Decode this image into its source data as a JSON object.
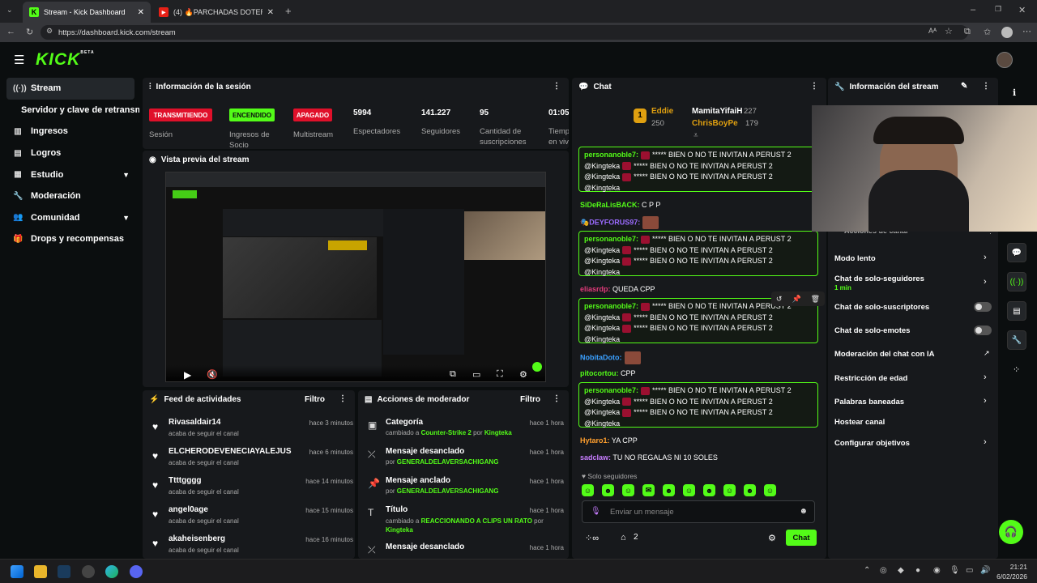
{
  "browser": {
    "tabs": [
      {
        "title": "Stream - Kick Dashboard"
      },
      {
        "title": "(4) 🔥PARCHADAS DOTERAS🔥 KIC"
      }
    ],
    "url": "https://dashboard.kick.com/stream"
  },
  "app": {
    "logo": "KICK",
    "logo_tag": "BETA"
  },
  "sidebar": {
    "items": [
      {
        "label": "Stream",
        "icon": "stream-icon"
      },
      {
        "label": "Servidor y clave de retransmisión",
        "icon": ""
      },
      {
        "label": "Ingresos",
        "icon": "chart-icon"
      },
      {
        "label": "Logros",
        "icon": "book-icon"
      },
      {
        "label": "Estudio",
        "icon": "grid-icon"
      },
      {
        "label": "Moderación",
        "icon": "wrench-icon"
      },
      {
        "label": "Comunidad",
        "icon": "people-icon"
      },
      {
        "label": "Drops y recompensas",
        "icon": "gift-icon"
      }
    ]
  },
  "session": {
    "title": "Información de la sesión",
    "badges": [
      {
        "label": "TRANSMITIENDO",
        "desc": "Sesión"
      },
      {
        "label": "ENCENDIDO",
        "desc": "Ingresos de Socio"
      },
      {
        "label": "APAGADO",
        "desc": "Multistream"
      }
    ],
    "stats": [
      {
        "value": "5994",
        "label": "Espectadores"
      },
      {
        "value": "141.227",
        "label": "Seguidores"
      },
      {
        "value": "95",
        "label": "Cantidad de suscripciones"
      },
      {
        "value": "01:05",
        "label": "Tiempo en vivo"
      }
    ]
  },
  "preview": {
    "title": "Vista previa del stream"
  },
  "feed": {
    "title": "Feed de actividades",
    "filter": "Filtro",
    "items": [
      {
        "name": "Rivasaldair14",
        "sub": "acaba de seguir el canal",
        "time": "hace 3 minutos"
      },
      {
        "name": "ELCHERODEVENECIAYALEJUS",
        "sub": "acaba de seguir el canal",
        "time": "hace 6 minutos"
      },
      {
        "name": "Ttttgggg",
        "sub": "acaba de seguir el canal",
        "time": "hace 14 minutos"
      },
      {
        "name": "angel0age",
        "sub": "acaba de seguir el canal",
        "time": "hace 15 minutos"
      },
      {
        "name": "akaheisenberg",
        "sub": "acaba de seguir el canal",
        "time": "hace 16 minutos"
      }
    ]
  },
  "modactions": {
    "title": "Acciones de moderador",
    "filter": "Filtro",
    "items": [
      {
        "name": "Categoría",
        "pre": "cambiado a",
        "target": "Counter-Strike 2",
        "mid": "por",
        "user": "Kingteka",
        "time": "hace 1 hora"
      },
      {
        "name": "Mensaje desanclado",
        "pre": "por",
        "target": "",
        "mid": "",
        "user": "GENERALDELAVERSACHIGANG",
        "time": "hace 1 hora"
      },
      {
        "name": "Mensaje anclado",
        "pre": "por",
        "target": "",
        "mid": "",
        "user": "GENERALDELAVERSACHIGANG",
        "time": "hace 1 hora"
      },
      {
        "name": "Título",
        "pre": "cambiado a",
        "target": "REACCIONANDO A CLIPS UN RATO",
        "mid": "por",
        "user": "Kingteka",
        "time": "hace 1 hora"
      },
      {
        "name": "Mensaje desanclado",
        "pre": "",
        "target": "",
        "mid": "",
        "user": "",
        "time": "hace 1 hora"
      }
    ]
  },
  "chat": {
    "title": "Chat",
    "leaders": [
      {
        "name": "Eddie",
        "count": "250",
        "rank": "1"
      },
      {
        "name": "MamitaYifaiH",
        "count": "227"
      },
      {
        "name": "ChrisBoyPe",
        "count": "179"
      }
    ],
    "messages": [
      {
        "type": "hl",
        "user": "personanoble7:",
        "lines": [
          "***** BIEN O NO TE INVITAN A PERUST 2",
          "***** BIEN O NO TE INVITAN A PERUST 2",
          "***** BIEN O NO TE INVITAN A PERUST 2"
        ],
        "mention": "@Kingteka"
      },
      {
        "type": "line",
        "user": "SiDeRaLisBACK:",
        "text": "C P P",
        "color": "#53fc18"
      },
      {
        "type": "line",
        "user": "DEYFORUS97:",
        "text": "",
        "color": "#9b6bff"
      },
      {
        "type": "hl",
        "user": "personanoble7:",
        "lines": [
          "***** BIEN O NO TE INVITAN A PERUST 2",
          "***** BIEN O NO TE INVITAN A PERUST 2",
          "***** BIEN O NO TE INVITAN A PERUST 2"
        ],
        "mention": "@Kingteka"
      },
      {
        "type": "line",
        "user": "eliasrdp:",
        "text": "QUEDA CPP",
        "color": "#e03a7a"
      },
      {
        "type": "hl",
        "user": "personanoble7:",
        "lines": [
          "***** BIEN O NO TE INVITAN A PERUST 2",
          "***** BIEN O NO TE INVITAN A PERUST 2",
          "***** BIEN O NO TE INVITAN A PERUST 2"
        ],
        "mention": "@Kingteka"
      },
      {
        "type": "line",
        "user": "NobitaDoto:",
        "text": "",
        "color": "#3ba0ff"
      },
      {
        "type": "line",
        "user": "pitocortou:",
        "text": "CPP",
        "color": "#53fc18"
      },
      {
        "type": "hl",
        "user": "personanoble7:",
        "lines": [
          "***** BIEN O NO TE INVITAN A PERUST 2",
          "***** BIEN O NO TE INVITAN A PERUST 2",
          "***** BIEN O NO TE INVITAN A PERUST 2"
        ],
        "mention": "@Kingteka"
      },
      {
        "type": "line",
        "user": "Hytaro1:",
        "text": "YA CPP",
        "color": "#ff9f2e"
      },
      {
        "type": "line",
        "user": "sadclaw:",
        "text": "TU NO REGALAS NI 10 SOLES",
        "color": "#c77dff"
      }
    ],
    "mode": "Solo seguidores",
    "placeholder": "Enviar un mensaje",
    "viewers_count": "2",
    "send": "Chat"
  },
  "streaminfo": {
    "title": "Información del stream",
    "hidden_header": "Acciones de canal",
    "items": [
      {
        "label": "Modo lento",
        "control": "arrow"
      },
      {
        "label": "Chat de solo-seguidores",
        "sub": "1 min",
        "control": "arrow"
      },
      {
        "label": "Chat de solo-suscriptores",
        "control": "toggle"
      },
      {
        "label": "Chat de solo-emotes",
        "control": "toggle"
      },
      {
        "label": "Moderación del chat con IA",
        "control": "external"
      },
      {
        "label": "Restricción de edad",
        "control": "arrow"
      },
      {
        "label": "Palabras baneadas",
        "control": "arrow"
      },
      {
        "label": "Hostear canal",
        "control": "none"
      },
      {
        "label": "Configurar objetivos",
        "control": "arrow"
      }
    ]
  },
  "taskbar": {
    "time": "21:21",
    "date": "6/02/2026"
  }
}
